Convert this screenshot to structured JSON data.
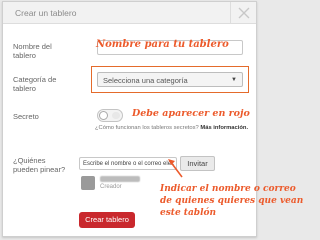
{
  "modal": {
    "title": "Crear un tablero"
  },
  "form": {
    "name_label_1": "Nombre del",
    "name_label_2": "tablero",
    "name_value": "",
    "category_label_1": "Categoría de",
    "category_label_2": "tablero",
    "category_selected": "Selecciona una categoría",
    "secret_label": "Secreto",
    "secret_help": "¿Cómo funcionan los tableros secretos?",
    "secret_help_link": "Más información.",
    "pinners_label_1": "¿Quiénes",
    "pinners_label_2": "pueden pinear?",
    "invite_placeholder": "Escribe el nombre o el correo elec",
    "invite_button": "Invitar",
    "collaborator_role": "Creador",
    "submit_button": "Crear tablero"
  },
  "annotations": {
    "name_note": "Nombre para tu tablero",
    "secret_note": "Debe aparecer en rojo",
    "invite_note_1": "Indicar el nombre o correo",
    "invite_note_2": "de quienes quieres que vean",
    "invite_note_3": "este tablón"
  },
  "colors": {
    "annotation": "#ec5a2b",
    "primary_button": "#c9282d",
    "highlight_border": "#e46b2b"
  },
  "icons": {
    "close": "close-icon",
    "dropdown": "chevron-down-icon",
    "annotation_arrow": "arrow-icon"
  }
}
